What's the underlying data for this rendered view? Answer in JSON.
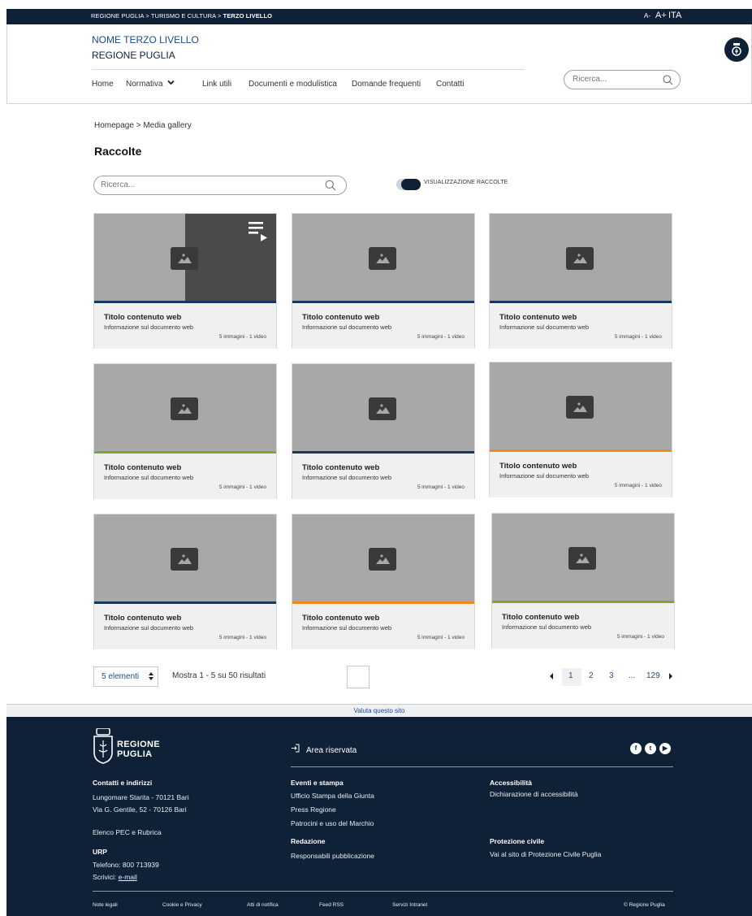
{
  "topbar": {
    "crumb": "REGIONE PUGLIA > TURISMO E CULTURA > ",
    "crumb_current": "TERZO LIVELLO",
    "font_small": "A-",
    "font_large": "A+",
    "language": "ITA"
  },
  "header": {
    "site_name": "NOME TERZO LIVELLO",
    "region": "REGIONE PUGLIA",
    "nav": [
      "Home",
      "Normativa",
      "Link utili",
      "Documenti e modulistica",
      "Domande frequenti",
      "Contatti"
    ],
    "search_placeholder": "Ricerca..."
  },
  "breadcrumb": "Homepage  >  Media gallery",
  "page_title": "Raccolte",
  "search_placeholder": "Ricerca...",
  "toggle_label": "VISUALIZZAZIONE RACCOLTE",
  "cards": [
    {
      "title": "Titolo contenuto web",
      "subtitle": "Informazione sul documento web",
      "count": "5 immagini - 1 video",
      "accent": "#17375e"
    },
    {
      "title": "Titolo contenuto web",
      "subtitle": "Informazione sul documento web",
      "count": "5 immagini - 1 video",
      "accent": "#17375e"
    },
    {
      "title": "Titolo contenuto web",
      "subtitle": "Informazione sul documento web",
      "count": "5 immagini - 1 video",
      "accent": "#17375e"
    },
    {
      "title": "Titolo contenuto web",
      "subtitle": "Informazione sul documento web",
      "count": "5 immagini - 1 video",
      "accent": "#7ea637"
    },
    {
      "title": "Titolo contenuto web",
      "subtitle": "Informazione sul documento web",
      "count": "5 immagini - 1 video",
      "accent": "#17375e"
    },
    {
      "title": "Titolo contenuto web",
      "subtitle": "Informazione sul documento web",
      "count": "5 immagini - 1 video",
      "accent": "#f08a1d"
    },
    {
      "title": "Titolo contenuto web",
      "subtitle": "Informazione sul documento web",
      "count": "5 immagini - 1 video",
      "accent": "#17375e"
    },
    {
      "title": "Titolo contenuto web",
      "subtitle": "Informazione sul documento web",
      "count": "5 immagini - 1 video",
      "accent": "#f08a1d"
    },
    {
      "title": "Titolo contenuto web",
      "subtitle": "Informazione sul documento web",
      "count": "5 immagini - 1 video",
      "accent": "#7ea637"
    }
  ],
  "pagination": {
    "per_page": "5 elementi",
    "results": "Mostra 1 - 5 su 50 risultati",
    "pages": [
      "1",
      "2",
      "3",
      "...",
      "129"
    ]
  },
  "footer": {
    "rate": "Valuta questo sito",
    "logo_line1": "REGIONE",
    "logo_line2": "PUGLIA",
    "area": "Area riservata",
    "contacts_heading": "Contatti e indirizzi",
    "address1": "Lungomare Starita - 70121 Bari",
    "address2": "Via G. Gentile, 52 - 70126 Bari",
    "pec": "Elenco PEC e Rubrica",
    "urp_heading": "URP",
    "phone": "Telefono: 800 713939",
    "write": "Scrivici: ",
    "email": "e-mail",
    "events_heading": "Eventi e stampa",
    "events": [
      "Ufficio Stampa della Giunta",
      "Press Regione",
      "Patrocini e uso del Marchio"
    ],
    "redazione_heading": "Redazione",
    "redazione": "Responsabili pubblicazione",
    "access_heading": "Accessibilità",
    "access": "Dichiarazione di accessibilità",
    "civil_heading": "Protezione civile",
    "civil": "Vai al sito di Protezione Civile Puglia",
    "bottom_links": [
      "Note legali",
      "Cookie e Privacy",
      "Atti di notifica",
      "Feed RSS",
      "Servizi Intranet"
    ],
    "copyright": "© Regione Puglia"
  }
}
